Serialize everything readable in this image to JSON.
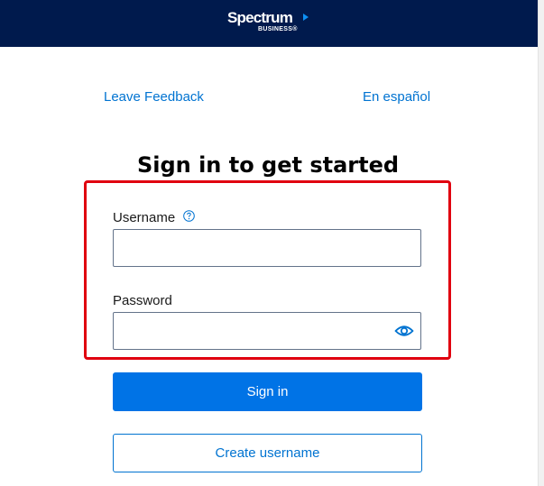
{
  "header": {
    "brand_name": "Spectrum",
    "brand_sub": "BUSINESS",
    "registered_mark": "®",
    "background_color": "#001a4d",
    "arrow_color": "#0d8ff2"
  },
  "links": {
    "feedback": "Leave Feedback",
    "language": "En español"
  },
  "form": {
    "title": "Sign in to get started",
    "username": {
      "label": "Username",
      "value": "",
      "help_icon": "question-circle-icon"
    },
    "password": {
      "label": "Password",
      "value": "",
      "toggle_icon": "eye-icon"
    },
    "signin_button": "Sign in",
    "create_button": "Create username"
  },
  "colors": {
    "link": "#0073d1",
    "primary_button": "#0073e6",
    "highlight_border": "#e0000f",
    "input_border": "#63738a"
  }
}
